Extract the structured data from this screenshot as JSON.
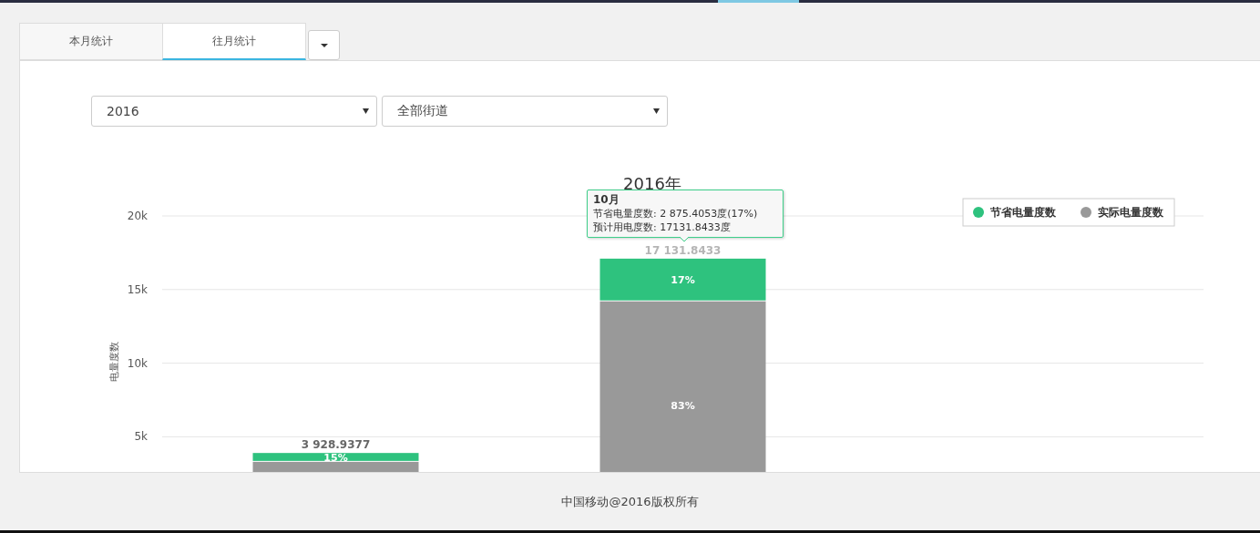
{
  "tabs": [
    {
      "label": "本月统计",
      "selected": false
    },
    {
      "label": "往月统计",
      "selected": true
    }
  ],
  "filters": [
    {
      "value": "2016"
    },
    {
      "value": "全部街道"
    }
  ],
  "chart": {
    "chart_data": {
      "type": "bar",
      "stacked": true,
      "title": "2016年",
      "ylabel": "电量度数",
      "ylim": [
        0,
        20000
      ],
      "yticks": [
        {
          "value": 5000,
          "label": "5k"
        },
        {
          "value": 10000,
          "label": "10k"
        },
        {
          "value": 15000,
          "label": "15k"
        },
        {
          "value": 20000,
          "label": "20k"
        }
      ],
      "series": [
        {
          "name": "节省电量度数",
          "color": "#2ec27e",
          "values": [
            600,
            2900,
            null
          ]
        },
        {
          "name": "实际电量度数",
          "color": "#999999",
          "values": [
            3300,
            14200,
            null
          ]
        }
      ],
      "grid": true,
      "legend": true
    },
    "bar_labels": [
      {
        "total": "3 928.9377",
        "saved_pct": "15%"
      },
      {
        "total": "17 131.8433",
        "saved_pct": "17%",
        "actual_pct": "83%"
      }
    ],
    "tooltip": {
      "title": "10月",
      "lines": [
        "节省电量度数: 2 875.4053度(17%)",
        "预计用电度数: 17131.8433度"
      ]
    }
  },
  "footer": "中国移动@2016版权所有"
}
